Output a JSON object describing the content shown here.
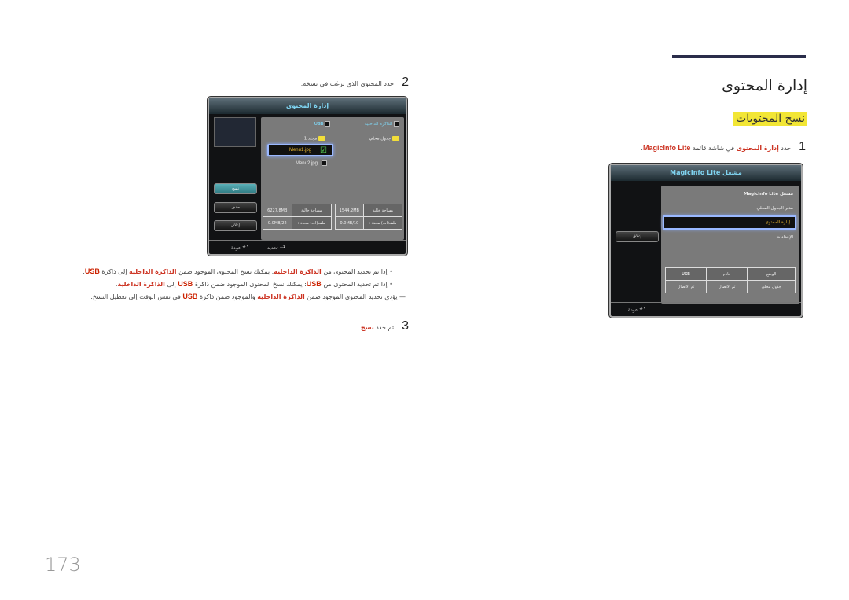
{
  "page": {
    "title": "إدارة المحتوى",
    "section": "نسخ المحتويات",
    "page_number": "173"
  },
  "step1": {
    "num": "1",
    "pre": "حدد ",
    "hl1": "إدارة المحتوى",
    "mid": " في شاشة قائمة ",
    "hl2": "MagicInfo Lite",
    "post": "."
  },
  "screen1": {
    "title": "مشغل MagicInfo Lite",
    "menu": [
      "مشغل MagicInfo Lite",
      "مدير الجدول المحلي",
      "إدارة المحتوى",
      "الإعدادات"
    ],
    "close_button": "إغلاق",
    "table": {
      "headers": [
        "الوضع",
        "خادم",
        "USB"
      ],
      "values": [
        "جدول محلي",
        "تم الاتصال",
        "تم الاتصال"
      ]
    },
    "footer_back": "عودة"
  },
  "step2": {
    "num": "2",
    "text": "حدد المحتوى الذي ترغب في نسخه."
  },
  "screen2": {
    "title": "إدارة المحتوى",
    "tabs": {
      "internal": "الذاكرة الداخلية",
      "usb": "USB"
    },
    "left_items": {
      "folder": "جدول محلي"
    },
    "right_items": {
      "folder": "مجلد 1",
      "file1": "Menu1.jpg",
      "file2": "Menu2.jpg"
    },
    "buttons": {
      "copy": "نسخ",
      "delete": "حذف",
      "close": "إغلاق"
    },
    "table_left": {
      "labels": [
        "مساحة خالية",
        "ملف(ات) محدد :"
      ],
      "values": [
        "1544.2MB",
        "0.0MB/10"
      ]
    },
    "table_right": {
      "labels": [
        "مساحة خالية",
        "ملف(ات) محدد :"
      ],
      "values": [
        "6227.8MB",
        "0.0MB/22"
      ]
    },
    "footer": {
      "select": "تحديد",
      "back": "عودة"
    }
  },
  "bullets": {
    "b1": {
      "a": "إذا تم تحديد المحتوى من ",
      "hl1": "الذاكرة الداخلية",
      "b": ": يمكنك نسخ المحتوى الموجود ضمن ",
      "hl2": "الذاكرة الداخلية",
      "c": " إلى ذاكرة ",
      "usb": "USB",
      "d": "."
    },
    "b2": {
      "a": "إذا تم تحديد المحتوى من ",
      "usb1": "USB",
      "b": ": يمكنك نسخ المحتوى الموجود ضمن ذاكرة ",
      "usb2": "USB",
      "c": " إلى ",
      "hl": "الذاكرة الداخلية",
      "d": "."
    },
    "note": {
      "a": "— يؤدي تحديد المحتوى الموجود ضمن ",
      "hl": "الذاكرة الداخلية",
      "b": " والموجود ضمن ذاكرة ",
      "usb": "USB",
      "c": " في نفس الوقت إلى تعطيل النسخ."
    }
  },
  "step3": {
    "num": "3",
    "pre": "ثم حدد ",
    "hl": "نسخ",
    "post": "."
  }
}
